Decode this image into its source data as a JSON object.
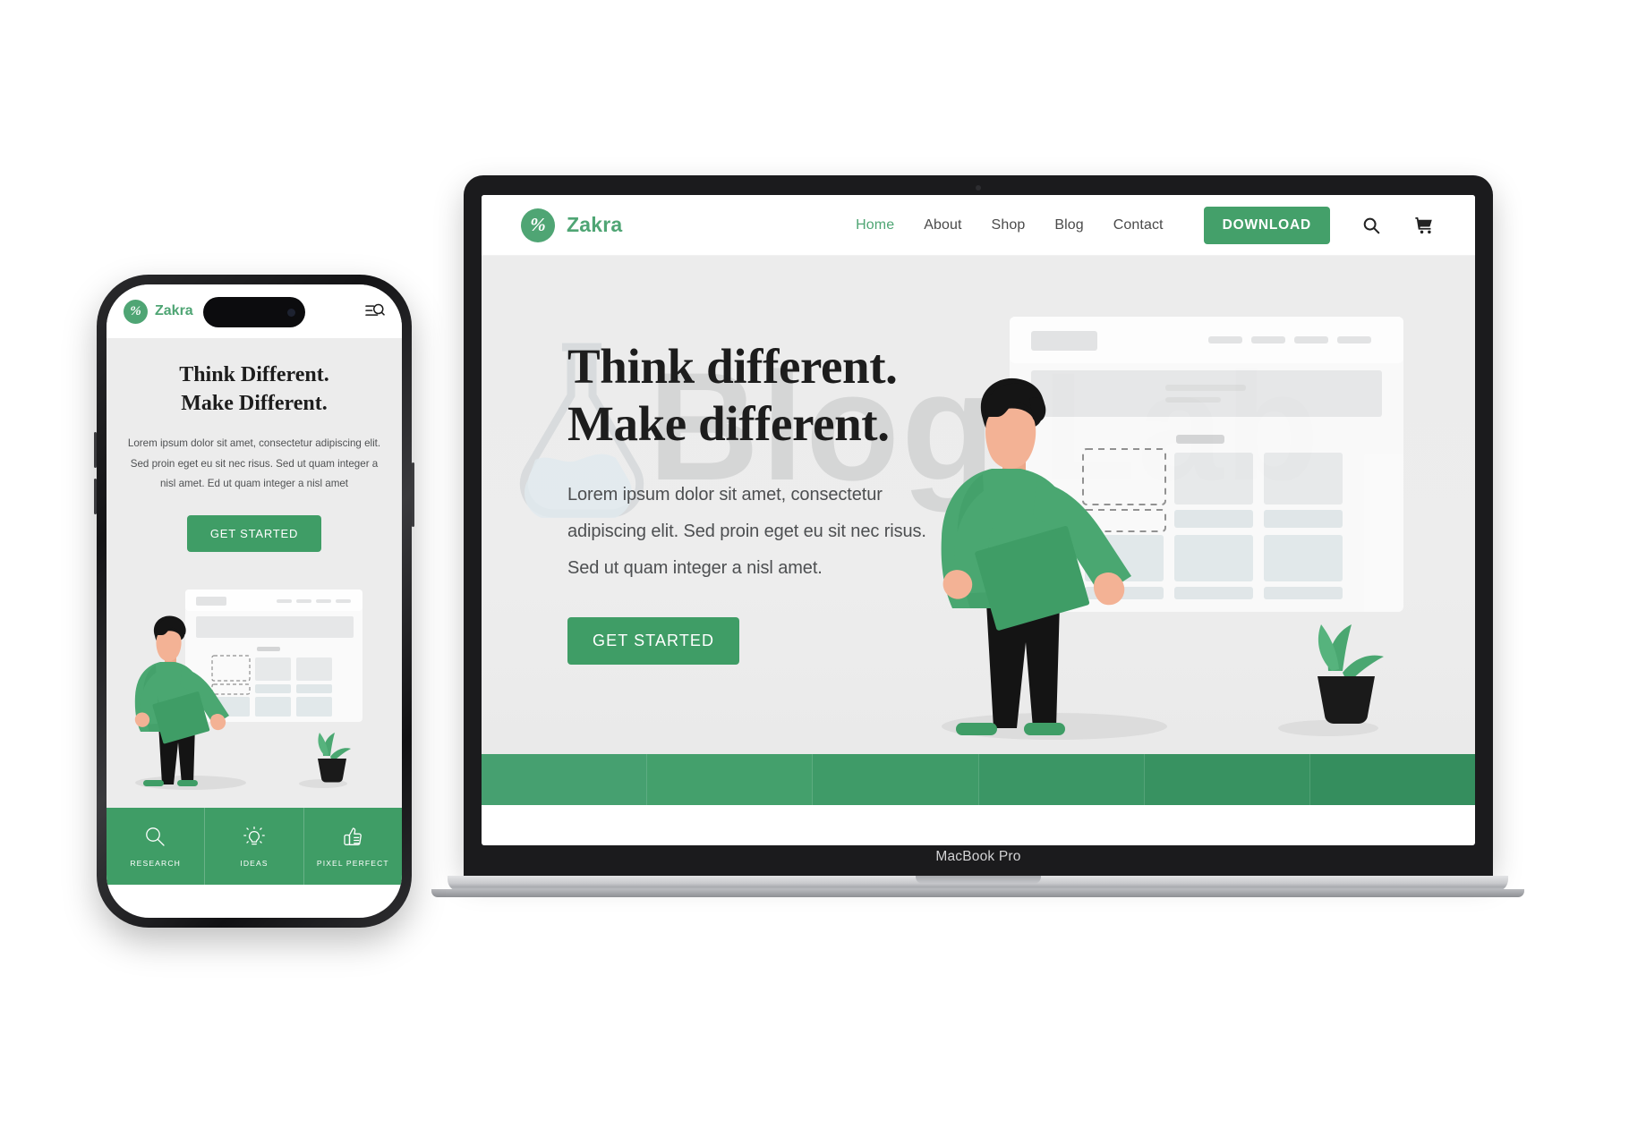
{
  "brand": {
    "name": "Zakra",
    "mark": "percent-slash-icon",
    "color": "#4fa574"
  },
  "desktop": {
    "device_label": "MacBook Pro",
    "nav": [
      {
        "label": "Home",
        "active": true
      },
      {
        "label": "About",
        "active": false
      },
      {
        "label": "Shop",
        "active": false
      },
      {
        "label": "Blog",
        "active": false
      },
      {
        "label": "Contact",
        "active": false
      }
    ],
    "download_label": "DOWNLOAD",
    "icons": [
      "search-icon",
      "cart-icon"
    ],
    "hero": {
      "heading_line1": "Think different.",
      "heading_line2": "Make different.",
      "paragraph": "Lorem ipsum dolor sit amet, consectetur adipiscing elit. Sed proin eget eu sit nec risus. Sed ut quam integer a nisl amet.",
      "cta_label": "GET STARTED"
    },
    "watermark": {
      "text": "Blog Lab",
      "icon": "flask-icon"
    },
    "accent": "#44a06a"
  },
  "phone": {
    "menu_icon": "menu-search-icon",
    "hero": {
      "heading_line1": "Think Different.",
      "heading_line2": "Make Different.",
      "paragraph": "Lorem ipsum dolor sit amet, consectetur adipiscing elit. Sed proin eget eu sit nec risus. Sed ut quam integer a nisl amet.  Ed ut quam integer a nisl amet",
      "cta_label": "GET STARTED"
    },
    "features": [
      {
        "label": "RESEARCH",
        "icon": "magnifier-icon"
      },
      {
        "label": "IDEAS",
        "icon": "lightbulb-icon"
      },
      {
        "label": "PIXEL PERFECT",
        "icon": "thumbs-up-icon"
      }
    ],
    "accent": "#3f9d66"
  }
}
